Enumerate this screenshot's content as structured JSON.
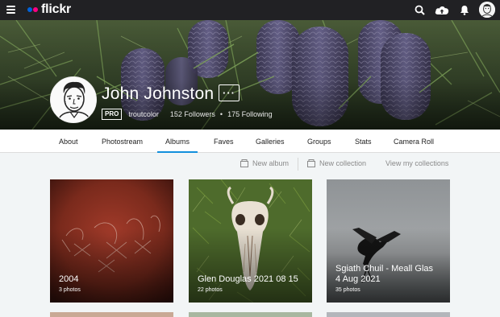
{
  "header": {
    "logo_text": "flickr",
    "logo_colors": {
      "blue": "#0063dc",
      "pink": "#ff0084"
    },
    "icons": [
      "menu-icon",
      "search-icon",
      "upload-cloud-icon",
      "notifications-bell-icon",
      "user-avatar"
    ]
  },
  "profile": {
    "name": "John Johnston",
    "more_label": "···",
    "badge": "PRO",
    "username": "troutcolor",
    "followers": "152 Followers",
    "separator": "•",
    "following": "175 Following"
  },
  "tabs": [
    {
      "label": "About"
    },
    {
      "label": "Photostream"
    },
    {
      "label": "Albums",
      "active": true
    },
    {
      "label": "Faves"
    },
    {
      "label": "Galleries"
    },
    {
      "label": "Groups"
    },
    {
      "label": "Stats"
    },
    {
      "label": "Camera Roll"
    }
  ],
  "actions": {
    "new_album": "New album",
    "new_collection": "New collection",
    "view_collections": "View my collections"
  },
  "albums": [
    {
      "title": "2004",
      "count": "3 photos"
    },
    {
      "title": "Glen Douglas 2021 08 15",
      "count": "22 photos"
    },
    {
      "title": "Sgiath Chuil - Meall Glas\n4 Aug 2021",
      "title_line1": "Sgiath Chuil - Meall Glas",
      "title_line2": "4 Aug 2021",
      "count": "35 photos"
    }
  ],
  "colors": {
    "accent": "#128fdc",
    "topbar": "#212124"
  }
}
